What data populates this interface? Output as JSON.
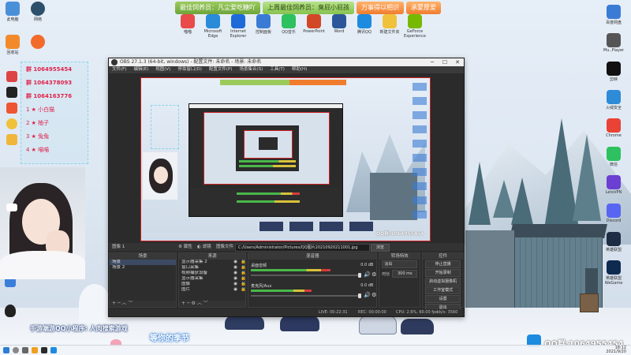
{
  "banner": {
    "items": [
      {
        "text": "最佳饲养员：凡尘爱吃糖吖",
        "style": "green"
      },
      {
        "text": "上周最佳饲养员：臭屁小屁孩",
        "style": "mint"
      },
      {
        "text": "万事得以相识",
        "style": "orange"
      },
      {
        "text": "承蒙厚爱",
        "style": "orange"
      }
    ]
  },
  "desktop_icons_top": [
    "喵喵",
    "Microsoft Edge",
    "Internet Explorer",
    "控制面板",
    "QQ音乐",
    "PowerPoint",
    "Word",
    "腾讯QQ",
    "新建文件夹",
    "GeForce Experience"
  ],
  "desktop_icons_left": [
    "此电脑",
    "网络",
    "回收站"
  ],
  "desktop_icons_right": [
    {
      "label": "百度网盘",
      "color": "#3a7bd5"
    },
    {
      "label": "Mu..Player",
      "color": "#555555"
    },
    {
      "label": "剪映",
      "color": "#111111"
    },
    {
      "label": "火绒安全",
      "color": "#2e8bd8"
    },
    {
      "label": "Chrome",
      "color": "#e94335"
    },
    {
      "label": "微信",
      "color": "#2ec15f"
    },
    {
      "label": "LetsVPN",
      "color": "#6b3fd1"
    },
    {
      "label": "Discord",
      "color": "#5865f2"
    },
    {
      "label": "英雄联盟",
      "color": "#1e2c44"
    },
    {
      "label": "英雄联盟 WeGame",
      "color": "#0e2a4f"
    }
  ],
  "chat": {
    "lines": [
      {
        "text": "群  1064955454",
        "num": true
      },
      {
        "text": "群  1064378093",
        "num": true
      },
      {
        "text": "群  1064163776",
        "num": true
      },
      {
        "text": "1  ★ 小白猫",
        "num": false
      },
      {
        "text": "2  ★ 柚子",
        "num": false
      },
      {
        "text": "3  ★ 兔兔",
        "num": false
      },
      {
        "text": "4  ★ 喵喵",
        "num": false
      }
    ]
  },
  "obs": {
    "title": "OBS 27.1.3 (64-bit, windows) - 配置文件: 未命名 - 场景: 未命名",
    "menu": [
      "文件(F)",
      "编辑(E)",
      "视图(V)",
      "停靠窗口(D)",
      "配置文件(P)",
      "场景集合(S)",
      "工具(T)",
      "帮助(H)"
    ],
    "min": "─",
    "max": "☐",
    "close": "✕",
    "toolbar": {
      "source_label": "图像 1",
      "props": "属性",
      "filters": "滤镜",
      "image_file": "图像文件",
      "path": "C:/Users/Administrator/Pictures/QQ图片20210920211001.jpg",
      "browse": "浏览"
    },
    "docks": {
      "scenes": {
        "title": "场景",
        "items": [
          "场景",
          "场景 2"
        ]
      },
      "sources": {
        "title": "来源",
        "items": [
          "显示器采集 2",
          "窗口采集",
          "视频捕获设备",
          "显示器采集",
          "图像",
          "图片"
        ]
      },
      "mixer": {
        "title": "混音器",
        "channels": [
          {
            "name": "桌面音频",
            "db": "0.0 dB",
            "level": 0.72
          },
          {
            "name": "麦克风/Aux",
            "db": "0.0 dB",
            "level": 0.55
          }
        ]
      },
      "transitions": {
        "title": "转场特效",
        "type": "淡出",
        "duration_label": "时长",
        "duration": "300 ms"
      },
      "controls": {
        "title": "控件",
        "buttons": [
          "停止直播",
          "开始录制",
          "启动虚拟摄像机",
          "工作室模式",
          "设置",
          "退出"
        ]
      }
    },
    "statusbar": {
      "live": "LIVE: 00:22:31",
      "rec": "REC: 00:00:00",
      "cpu": "CPU: 2.6%, 60.00 fps",
      "kbps": "kb/s: 3560"
    }
  },
  "captions": {
    "bottom_left": "手游端游QQ小程序: 人肉搜索游戏",
    "song": "等你的季节",
    "qq_group": "QQ群:1064955454"
  },
  "taskbar": {
    "time": "18:12",
    "date": "2021/9/20"
  }
}
